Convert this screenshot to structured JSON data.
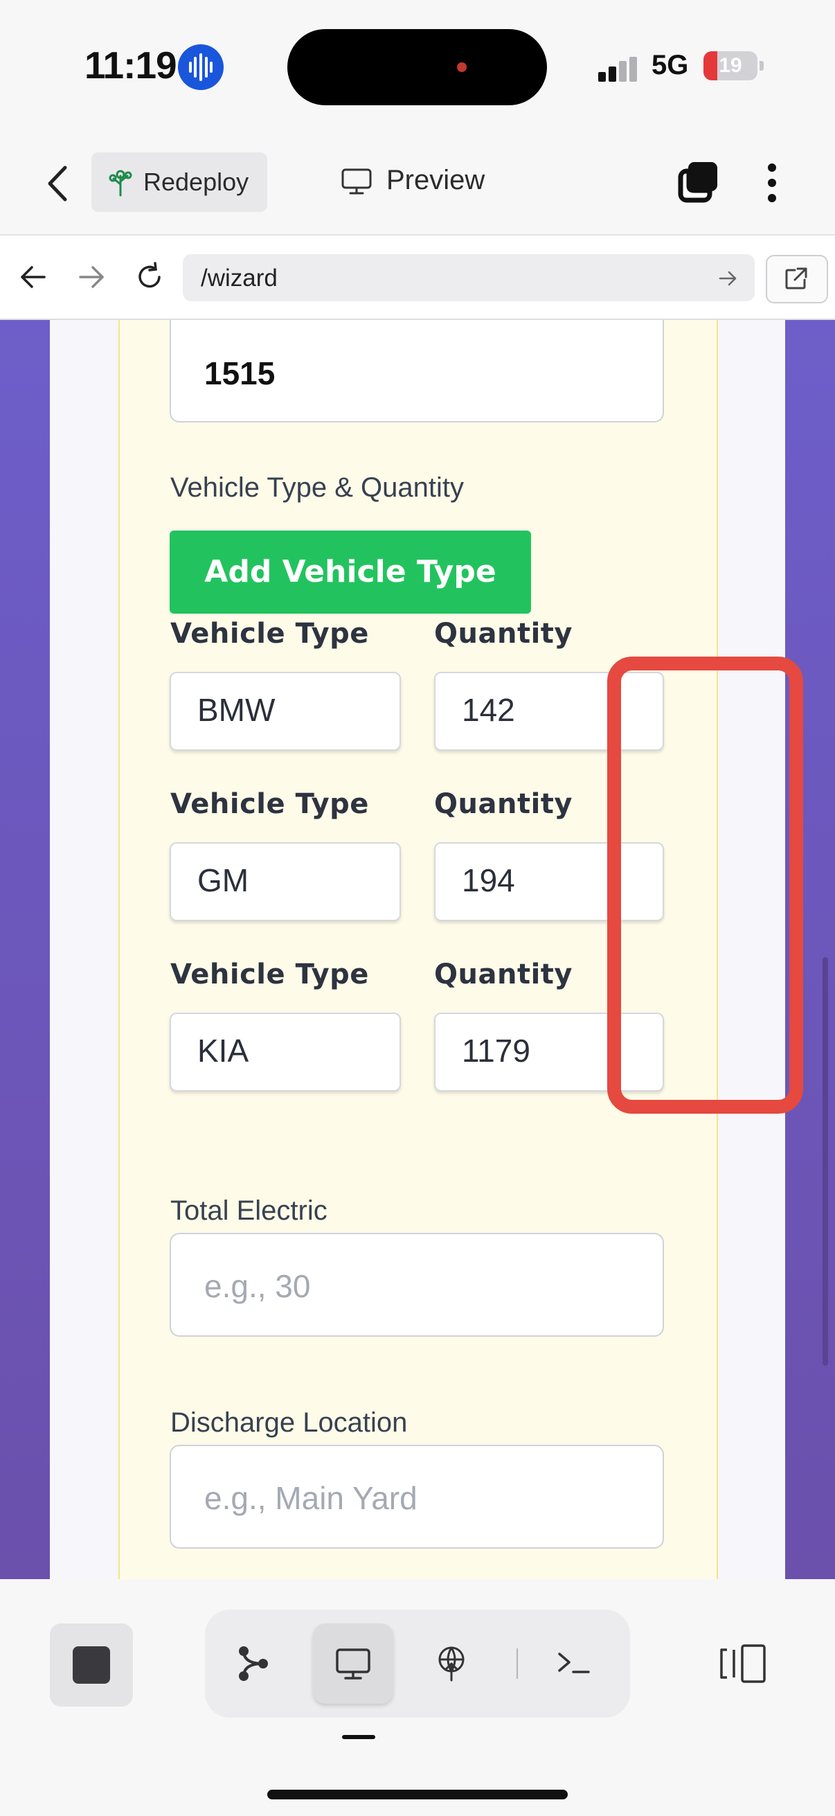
{
  "status_bar": {
    "time": "11:19",
    "network": "5G",
    "battery": "19",
    "battery_level": 0.19
  },
  "header": {
    "redeploy_label": "Redeploy",
    "preview_label": "Preview"
  },
  "browser": {
    "url": "/wizard"
  },
  "form": {
    "top_input_value": "1515",
    "vehicle_section_label": "Vehicle Type & Quantity",
    "add_vehicle_label": "Add Vehicle Type",
    "vehicle_col_label": "Vehicle Type",
    "quantity_col_label": "Quantity",
    "vehicles": [
      {
        "type": "BMW",
        "quantity": "142"
      },
      {
        "type": "GM",
        "quantity": "194"
      },
      {
        "type": "KIA",
        "quantity": "1179"
      }
    ],
    "total_electric_label": "Total Electric",
    "total_electric_placeholder": "e.g., 30",
    "discharge_location_label": "Discharge Location",
    "discharge_location_placeholder": "e.g., Main Yard"
  },
  "colors": {
    "accent_green": "#22c35e",
    "annotation_red": "#e5493f",
    "panel_yellow": "#fefbe8",
    "background_purple": "#6b55b3"
  },
  "icons": [
    "voice-icon",
    "back-chevron-icon",
    "redeploy-tree-icon",
    "monitor-icon",
    "tabs-icon",
    "kebab-menu-icon",
    "arrow-left-icon",
    "arrow-right-icon",
    "reload-icon",
    "go-arrow-icon",
    "external-link-icon",
    "stop-icon",
    "branch-icon",
    "desktop-icon",
    "deploy-icon",
    "terminal-icon",
    "panel-toggle-icon"
  ]
}
